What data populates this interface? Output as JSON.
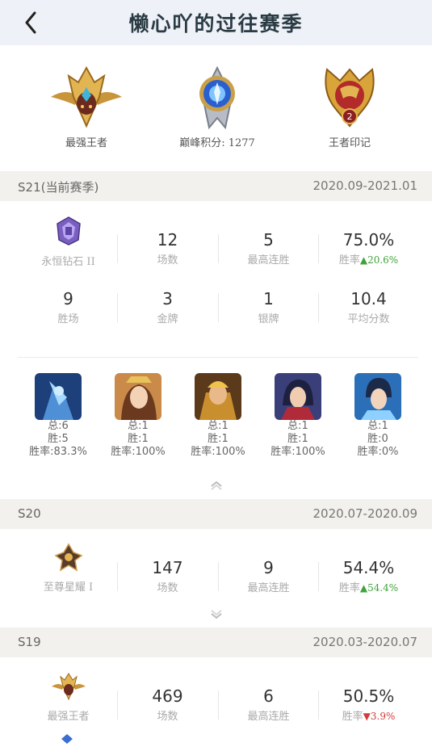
{
  "header": {
    "title": "懒心吖的过往赛季"
  },
  "badges": [
    {
      "label": "最强王者",
      "icon": "king-crest-icon"
    },
    {
      "label": "巅峰积分: 1277",
      "icon": "peak-crystal-icon"
    },
    {
      "label": "王者印记",
      "icon": "king-mark-icon",
      "number": "2"
    }
  ],
  "seasons": {
    "s21": {
      "name": "S21(当前赛季)",
      "date": "2020.09-2021.01",
      "rank": "永恒钻石 II",
      "row1": [
        {
          "value": "12",
          "label": "场数"
        },
        {
          "value": "5",
          "label": "最高连胜"
        },
        {
          "value": "75.0%",
          "label": "胜率",
          "delta": "20.6%"
        }
      ],
      "row2": [
        {
          "value": "9",
          "label": "胜场"
        },
        {
          "value": "3",
          "label": "金牌"
        },
        {
          "value": "1",
          "label": "银牌"
        },
        {
          "value": "10.4",
          "label": "平均分数"
        }
      ],
      "heroes": [
        {
          "total": "总:6",
          "wins": "胜:5",
          "rate": "胜率:83.3%"
        },
        {
          "total": "总:1",
          "wins": "胜:1",
          "rate": "胜率:100%"
        },
        {
          "total": "总:1",
          "wins": "胜:1",
          "rate": "胜率:100%"
        },
        {
          "total": "总:1",
          "wins": "胜:1",
          "rate": "胜率:100%"
        },
        {
          "total": "总:1",
          "wins": "胜:0",
          "rate": "胜率:0%"
        }
      ]
    },
    "s20": {
      "name": "S20",
      "date": "2020.07-2020.09",
      "rank": "至尊星耀 I",
      "row1": [
        {
          "value": "147",
          "label": "场数"
        },
        {
          "value": "9",
          "label": "最高连胜"
        },
        {
          "value": "54.4%",
          "label": "胜率",
          "delta": "54.4%"
        }
      ]
    },
    "s19": {
      "name": "S19",
      "date": "2020.03-2020.07",
      "rank": "最强王者",
      "row1": [
        {
          "value": "469",
          "label": "场数"
        },
        {
          "value": "6",
          "label": "最高连胜"
        },
        {
          "value": "50.5%",
          "label": "胜率",
          "delta": "3.9%"
        }
      ]
    }
  },
  "colors": {
    "up": "#3fa33a",
    "down": "#d23c3c",
    "gold": "#d9a53a"
  }
}
